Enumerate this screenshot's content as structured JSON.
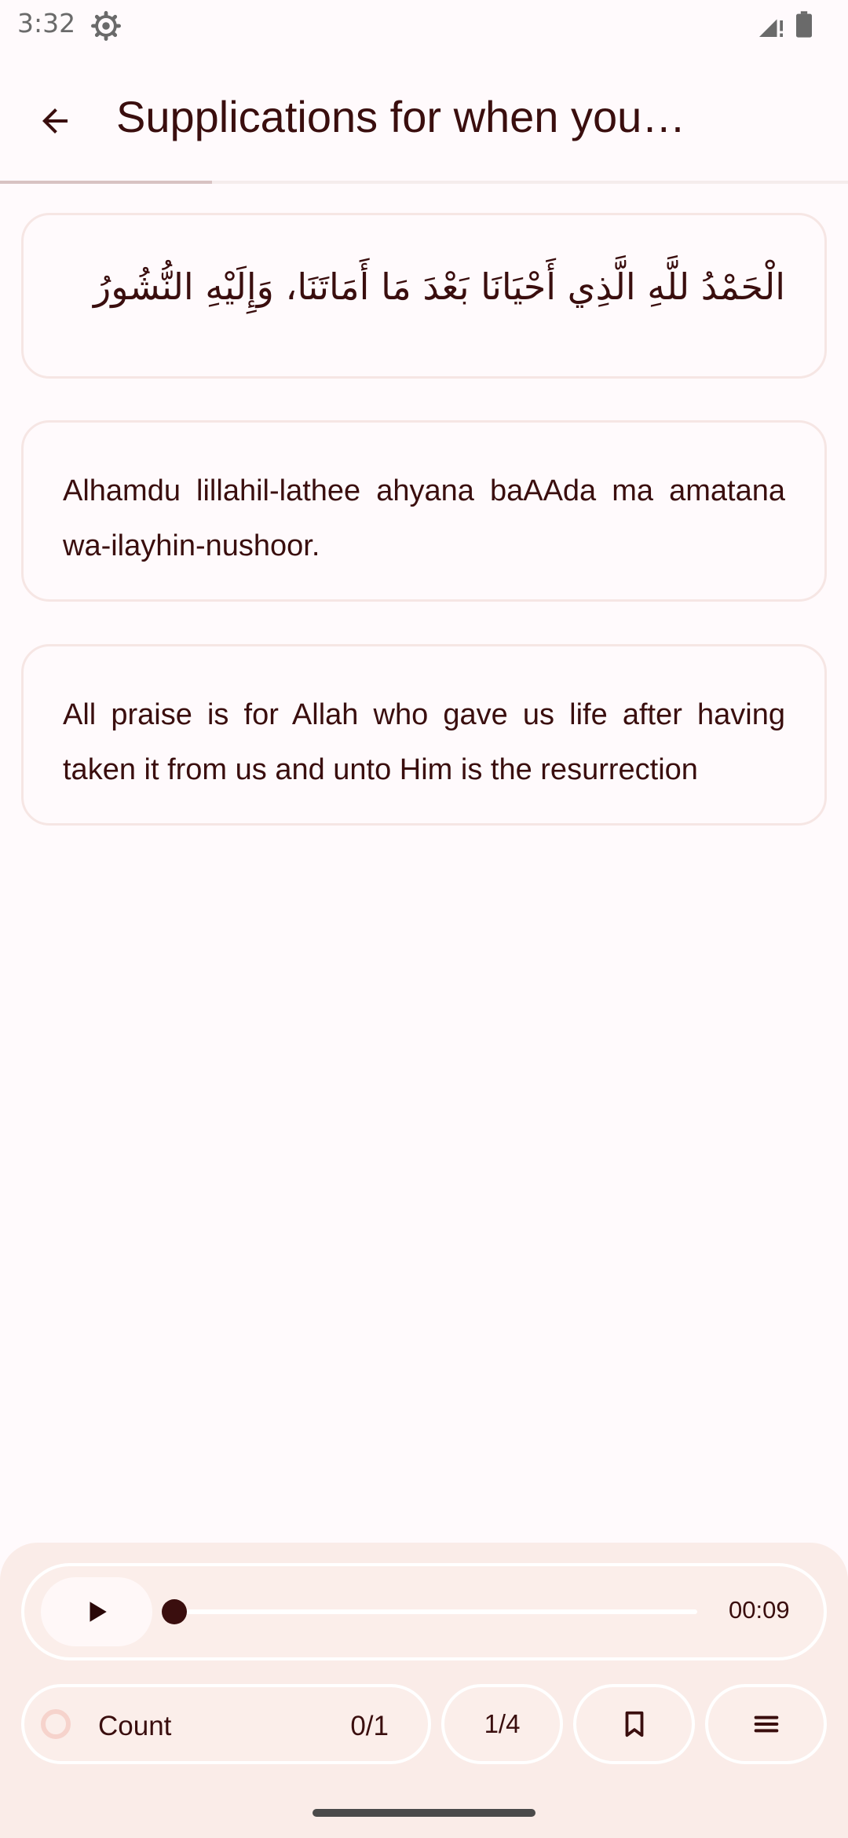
{
  "status_bar": {
    "time": "3:32",
    "icons": [
      "settings-gear-icon",
      "signal-icon",
      "battery-icon"
    ]
  },
  "app_bar": {
    "back_icon": "arrow-back-icon",
    "title": "Supplications for when you…"
  },
  "reading_progress": 0.25,
  "cards": {
    "arabic": "الْحَمْدُ للَّهِ الَّذِي أَحْيَانَا بَعْدَ مَا أَمَاتَنَا، وَإِلَيْهِ النُّشُورُ",
    "transliteration": "Alhamdu lillahil-lathee ahyana baAAda ma amatana wa-ilayhin-nushoor.",
    "translation": "All praise is for Allah who gave us life after having taken it from us and unto Him is the resurrection"
  },
  "player": {
    "play_icon": "play-icon",
    "position": 0,
    "duration_label": "00:09"
  },
  "bottom_actions": {
    "count_label": "Count",
    "count_value": "0/1",
    "page_value": "1/4",
    "bookmark_icon": "bookmark-icon",
    "menu_icon": "menu-icon"
  },
  "colors": {
    "background": "#fffafc",
    "text": "#3a0e0e",
    "card_border": "#f6e6e4",
    "panel": "#faece8",
    "count_ring": "#f6d3cc"
  }
}
